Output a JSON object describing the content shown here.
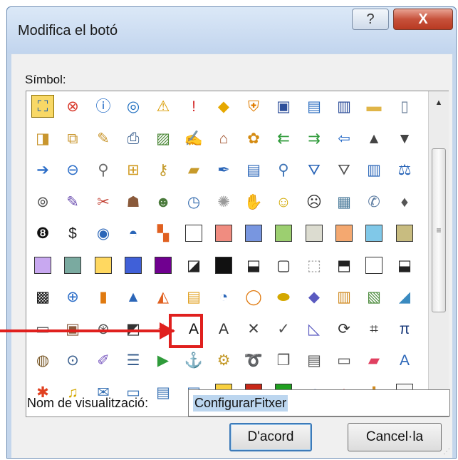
{
  "dialog": {
    "title": "Modifica el botó",
    "help_label": "?",
    "close_label": "X",
    "symbol_label": "Símbol:",
    "display_name_label": "Nom de visualització:",
    "display_name_value": "ConfigurarFitxer",
    "ok_label": "D'acord",
    "cancel_label": "Cancel·la"
  },
  "scrollbar": {
    "up_glyph": "▲",
    "down_glyph": "▼",
    "thumb_glyph": "≡"
  },
  "icons": [
    [
      {
        "icon": "network-icon",
        "g": "⛶",
        "c": "#1f5fa8",
        "sel": true
      },
      {
        "icon": "error-icon",
        "g": "⊗",
        "c": "#d83a2c"
      },
      {
        "icon": "info-icon",
        "g": "ⓘ",
        "c": "#1d67c4"
      },
      {
        "icon": "target-icon",
        "g": "◎",
        "c": "#1f6fc0"
      },
      {
        "icon": "warning-icon",
        "g": "⚠",
        "c": "#d99b00"
      },
      {
        "icon": "exclamation-icon",
        "g": "!",
        "c": "#d42a2a"
      },
      {
        "icon": "diamond-warning-icon",
        "g": "◆",
        "c": "#e6a800"
      },
      {
        "icon": "shield-icon",
        "g": "⛨",
        "c": "#e07c00"
      },
      {
        "icon": "save-icon",
        "g": "▣",
        "c": "#2d4e9a"
      },
      {
        "icon": "save-as-icon",
        "g": "▤",
        "c": "#2d6ec0"
      },
      {
        "icon": "save-all-icon",
        "g": "▥",
        "c": "#2d4e9a"
      },
      {
        "icon": "folder-icon",
        "g": "▬",
        "c": "#e0b548"
      },
      {
        "icon": "new-document-icon",
        "g": "▯",
        "c": "#6b7f99"
      }
    ],
    [
      {
        "icon": "open-folder-icon",
        "g": "◨",
        "c": "#c9962e"
      },
      {
        "icon": "copy-folder-icon",
        "g": "⧉",
        "c": "#c9962e"
      },
      {
        "icon": "edit-folder-icon",
        "g": "✎",
        "c": "#c9962e"
      },
      {
        "icon": "print-icon",
        "g": "⎙",
        "c": "#3a5f8e"
      },
      {
        "icon": "picture-icon",
        "g": "▨",
        "c": "#4f8a3b"
      },
      {
        "icon": "edit-document-icon",
        "g": "✍",
        "c": "#4b7fc0"
      },
      {
        "icon": "home-icon",
        "g": "⌂",
        "c": "#a0522d"
      },
      {
        "icon": "palette-icon",
        "g": "✿",
        "c": "#d48a10"
      },
      {
        "icon": "back-double-icon",
        "g": "⇇",
        "c": "#2f9b3a"
      },
      {
        "icon": "forward-double-icon",
        "g": "⇉",
        "c": "#2f9b3a"
      },
      {
        "icon": "left-arrow-icon",
        "g": "⇦",
        "c": "#2c6ec8"
      },
      {
        "icon": "up-arrow-icon",
        "g": "▲",
        "c": "#444444"
      },
      {
        "icon": "down-arrow-icon",
        "g": "▼",
        "c": "#444444"
      }
    ],
    [
      {
        "icon": "right-arrow-icon",
        "g": "➔",
        "c": "#2c6ec8"
      },
      {
        "icon": "back-circle-icon",
        "g": "⊖",
        "c": "#2c6ec8"
      },
      {
        "icon": "pin-icon",
        "g": "⚲",
        "c": "#6b6b6b"
      },
      {
        "icon": "lock-icon",
        "g": "⊞",
        "c": "#d09a20"
      },
      {
        "icon": "key-icon",
        "g": "⚷",
        "c": "#c49a2a"
      },
      {
        "icon": "eraser-icon",
        "g": "▰",
        "c": "#c79a2a"
      },
      {
        "icon": "pen-icon",
        "g": "✒",
        "c": "#2b66b8"
      },
      {
        "icon": "form-icon",
        "g": "▤",
        "c": "#2b66b8"
      },
      {
        "icon": "zoom-icon",
        "g": "⚲",
        "c": "#3d73b5"
      },
      {
        "icon": "filter-icon",
        "g": "⛛",
        "c": "#2b66b8"
      },
      {
        "icon": "filter-outline-icon",
        "g": "⛛",
        "c": "#555555"
      },
      {
        "icon": "book-icon",
        "g": "▥",
        "c": "#2b66b8"
      },
      {
        "icon": "scales-icon",
        "g": "⚖",
        "c": "#2b66b8"
      }
    ],
    [
      {
        "icon": "rings-icon",
        "g": "⊚",
        "c": "#555555"
      },
      {
        "icon": "microphone-icon",
        "g": "✎",
        "c": "#6a4caf"
      },
      {
        "icon": "tools-icon",
        "g": "✂",
        "c": "#c0392b"
      },
      {
        "icon": "person-icon",
        "g": "☗",
        "c": "#8a5a3b"
      },
      {
        "icon": "people-icon",
        "g": "☻",
        "c": "#4a7a3b"
      },
      {
        "icon": "clock-icon",
        "g": "◷",
        "c": "#3a6fb0"
      },
      {
        "icon": "sparkle-icon",
        "g": "✺",
        "c": "#9a9a9a"
      },
      {
        "icon": "hand-icon",
        "g": "✋",
        "c": "#c49a2a"
      },
      {
        "icon": "smiley-icon",
        "g": "☺",
        "c": "#d1a800"
      },
      {
        "icon": "sad-face-icon",
        "g": "☹",
        "c": "#333333"
      },
      {
        "icon": "calculator-icon",
        "g": "▦",
        "c": "#4a7a9a"
      },
      {
        "icon": "phone-icon",
        "g": "✆",
        "c": "#5a7aa0"
      },
      {
        "icon": "piggy-bank-icon",
        "g": "♦",
        "c": "#555555"
      }
    ],
    [
      {
        "icon": "eight-ball-icon",
        "g": "❽",
        "c": "#111111"
      },
      {
        "icon": "money-icon",
        "g": "$",
        "c": "#222222"
      },
      {
        "icon": "eye-icon",
        "g": "◉",
        "c": "#2b66b8"
      },
      {
        "icon": "disc-icon",
        "g": "◓",
        "c": "#2b66b8"
      },
      {
        "icon": "tiles-icon",
        "g": "▚",
        "c": "#e06020"
      },
      {
        "sw": "#ffffff"
      },
      {
        "sw": "#f08c80"
      },
      {
        "sw": "#7896e0"
      },
      {
        "sw": "#9ccf70"
      },
      {
        "sw": "#dcdcd0"
      },
      {
        "sw": "#f4a870"
      },
      {
        "sw": "#80c8e8"
      },
      {
        "sw": "#c8bc80"
      }
    ],
    [
      {
        "sw": "#c8a8f0"
      },
      {
        "sw": "#7aaaa0"
      },
      {
        "sw": "#ffd860"
      },
      {
        "sw": "#4060d8"
      },
      {
        "sw": "#700090"
      },
      {
        "icon": "diagonal-fill-icon",
        "g": "◪",
        "c": "#222222"
      },
      {
        "sw": "#111111"
      },
      {
        "icon": "half-fill-icon",
        "g": "⬓",
        "c": "#222222"
      },
      {
        "icon": "outline-square-icon",
        "g": "▢",
        "c": "#222222"
      },
      {
        "icon": "dotted-square-icon",
        "g": "⬚",
        "c": "#999999"
      },
      {
        "icon": "bottom-fill-icon",
        "g": "⬒",
        "c": "#222222"
      },
      {
        "sw": "#ffffff"
      },
      {
        "icon": "top-fill-icon",
        "g": "⬓",
        "c": "#222222"
      }
    ],
    [
      {
        "icon": "checker-icon",
        "g": "▩",
        "c": "#111111"
      },
      {
        "icon": "forward-circle-icon",
        "g": "⊕",
        "c": "#2c6ec8"
      },
      {
        "icon": "bar-chart-icon",
        "g": "▮",
        "c": "#e07a10"
      },
      {
        "icon": "cone-icon",
        "g": "▲",
        "c": "#2b66b8"
      },
      {
        "icon": "area-chart-icon",
        "g": "◭",
        "c": "#e06020"
      },
      {
        "icon": "gantt-icon",
        "g": "▤",
        "c": "#e0a020"
      },
      {
        "icon": "pie-chart-icon",
        "g": "◔",
        "c": "#2b66b8"
      },
      {
        "icon": "donut-chart-icon",
        "g": "◯",
        "c": "#e07a10"
      },
      {
        "icon": "cylinders-icon",
        "g": "⬬",
        "c": "#d4a800"
      },
      {
        "icon": "book-stack-icon",
        "g": "◆",
        "c": "#5a5ac0"
      },
      {
        "icon": "books-icon",
        "g": "▥",
        "c": "#d08a20"
      },
      {
        "icon": "bookmarks-icon",
        "g": "▧",
        "c": "#4a8a3b"
      },
      {
        "icon": "landscape-icon",
        "g": "◢",
        "c": "#3a8ac0"
      }
    ],
    [
      {
        "icon": "frame-icon",
        "g": "▭",
        "c": "#555555"
      },
      {
        "icon": "contact-card-icon",
        "g": "▣",
        "c": "#8a5a3b"
      },
      {
        "icon": "film-reel-icon",
        "g": "⊛",
        "c": "#555555"
      },
      {
        "icon": "gradient-icon",
        "g": "◩",
        "c": "#333333"
      },
      {
        "icon": "star-pen-icon",
        "g": "✦",
        "c": "#c04040"
      },
      {
        "icon": "font-a-icon",
        "g": "A",
        "c": "#111111"
      },
      {
        "icon": "font-a-bold-icon",
        "g": "A",
        "c": "#333333"
      },
      {
        "icon": "x-mark-icon",
        "g": "✕",
        "c": "#444444"
      },
      {
        "icon": "check-mark-icon",
        "g": "✓",
        "c": "#555555"
      },
      {
        "icon": "ruler-icon",
        "g": "◺",
        "c": "#5a5ac0"
      },
      {
        "icon": "refresh-icon",
        "g": "⟳",
        "c": "#333333"
      },
      {
        "icon": "matrix-icon",
        "g": "⌗",
        "c": "#333333"
      },
      {
        "icon": "pi-icon",
        "g": "π",
        "c": "#1a3a7a"
      }
    ],
    [
      {
        "icon": "paint-bucket-icon",
        "g": "◍",
        "c": "#7a5a2a"
      },
      {
        "icon": "binoculars-icon",
        "g": "⊙",
        "c": "#3a5f8e"
      },
      {
        "icon": "pencil-icon",
        "g": "✐",
        "c": "#7a5ac0"
      },
      {
        "icon": "list-icon",
        "g": "☰",
        "c": "#3a5f8e"
      },
      {
        "icon": "play-icon",
        "g": "▶",
        "c": "#2f9b3a"
      },
      {
        "icon": "anchor-icon",
        "g": "⚓",
        "c": "#333333"
      },
      {
        "icon": "settings-icon",
        "g": "⚙",
        "c": "#c49a2a"
      },
      {
        "icon": "lasso-icon",
        "g": "➰",
        "c": "#c04040"
      },
      {
        "icon": "copy-icon",
        "g": "❐",
        "c": "#555555"
      },
      {
        "icon": "paste-icon",
        "g": "▤",
        "c": "#555555"
      },
      {
        "icon": "folder-tab-icon",
        "g": "▭",
        "c": "#555555"
      },
      {
        "icon": "eraser-pink-icon",
        "g": "▰",
        "c": "#e04060"
      },
      {
        "icon": "font-icon",
        "g": "A",
        "c": "#2b66b8"
      }
    ],
    [
      {
        "icon": "butterfly-icon",
        "g": "✱",
        "c": "#e04020"
      },
      {
        "icon": "bell-icon",
        "g": "♫",
        "c": "#d4a800"
      },
      {
        "icon": "envelope-icon",
        "g": "✉",
        "c": "#3a73b5"
      },
      {
        "icon": "card-icon",
        "g": "▭",
        "c": "#3a73b5"
      },
      {
        "icon": "card-lines-icon",
        "g": "▤",
        "c": "#3a73b5"
      },
      {
        "icon": "card-alt-icon",
        "g": "▣",
        "c": "#3a73b5"
      },
      {
        "sw": "#f8d040"
      },
      {
        "sw": "#c82818"
      },
      {
        "sw": "#20a020"
      },
      {
        "icon": "browser-icon",
        "g": "ℯ",
        "c": "#1a6ad4"
      },
      {
        "icon": "home-red-icon",
        "g": "⌂",
        "c": "#d02020"
      },
      {
        "icon": "signpost-icon",
        "g": "✜",
        "c": "#d08a20"
      },
      {
        "sw": "#f8f8f8"
      }
    ]
  ]
}
